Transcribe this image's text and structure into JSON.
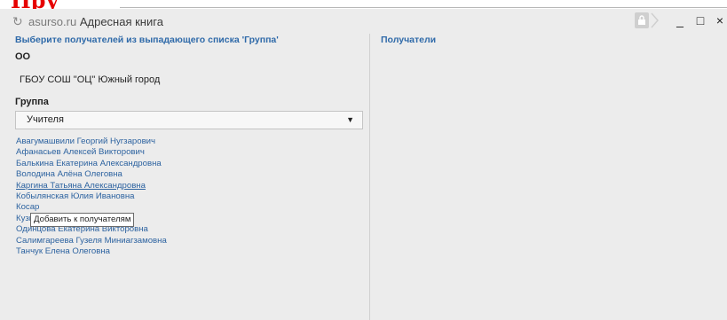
{
  "window": {
    "reload_icon": "↻",
    "domain": "asurso.ru",
    "title": "Адресная книга",
    "lock_icon": "lock-icon",
    "controls": {
      "minimize": "_",
      "maximize": "□",
      "close": "×"
    }
  },
  "left": {
    "hint": "Выберите получателей из выпадающего списка 'Группа'",
    "oo_label": "ОО",
    "school": "ГБОУ СОШ \"ОЦ\" Южный город",
    "group_label": "Группа",
    "group_select": {
      "selected": "Учителя"
    },
    "people": [
      "Авагумашвили Георгий Нугзарович",
      "Афанасьев Алексей Викторович",
      "Балькина Екатерина Александровна",
      "Володина Алёна Олеговна",
      "Каргина Татьяна Александровна",
      "Кобылянская Юлия Ивановна",
      "Косар",
      "Кузютина Ольга Валерьевна",
      "Одинцова Екатерина Викторовна",
      "Салимгареева Гузеля Миниагзамовна",
      "Танчук Елена Олеговна"
    ],
    "tooltip": "Добавить к получателям"
  },
  "right": {
    "title": "Получатели"
  },
  "colors": {
    "link": "#2d63a0",
    "header_blue": "#2f6aa9",
    "background": "#ececec",
    "partial_heading": "#e60000"
  },
  "partial_heading_text": "Пру"
}
